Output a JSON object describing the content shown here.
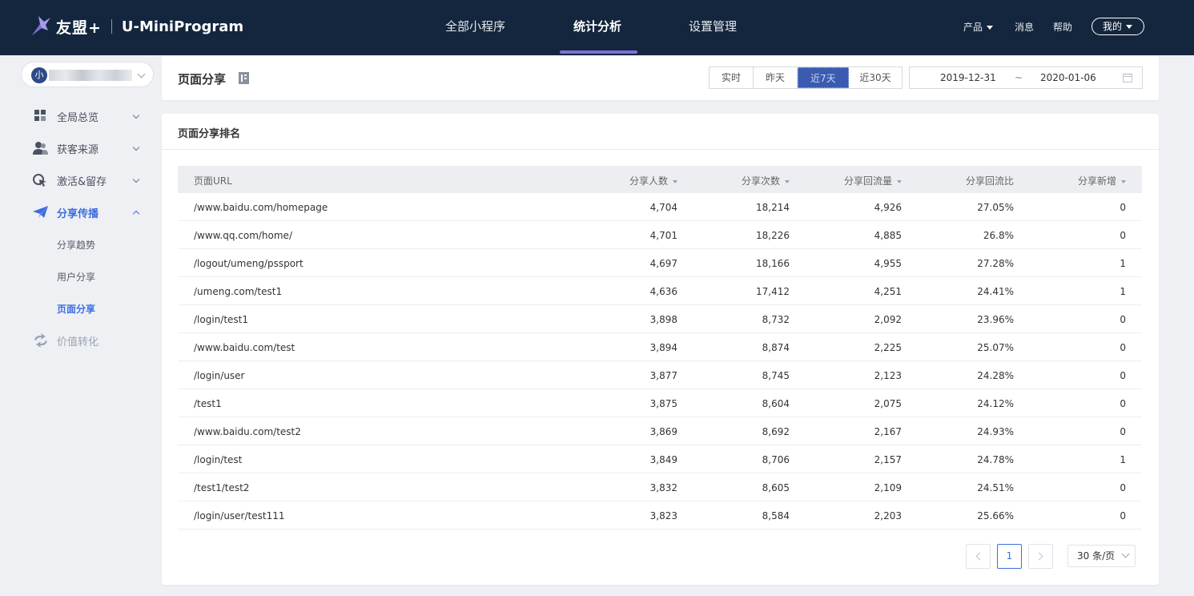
{
  "brand": {
    "name": "友盟+",
    "product": "U-MiniProgram"
  },
  "nav": {
    "tabs": [
      {
        "label": "全部小程序"
      },
      {
        "label": "统计分析"
      },
      {
        "label": "设置管理"
      }
    ],
    "active_tab": "统计分析",
    "right": {
      "product": "产品",
      "messages": "消息",
      "help": "帮助",
      "me": "我的"
    }
  },
  "sidebar": {
    "app_avatar": "小",
    "items": [
      {
        "label": "全局总览",
        "icon": "grid-icon"
      },
      {
        "label": "获客来源",
        "icon": "users-icon"
      },
      {
        "label": "激活&留存",
        "icon": "cursor-icon"
      },
      {
        "label": "分享传播",
        "icon": "paper-plane-icon"
      },
      {
        "label": "价值转化",
        "icon": "refresh-icon"
      }
    ],
    "subitems": [
      {
        "label": "分享趋势"
      },
      {
        "label": "用户分享"
      },
      {
        "label": "页面分享"
      }
    ],
    "active_subitem": "页面分享"
  },
  "header": {
    "title": "页面分享",
    "range_buttons": [
      "实时",
      "昨天",
      "近7天",
      "近30天"
    ],
    "active_range": "近7天",
    "date_start": "2019-12-31",
    "date_sep": "~",
    "date_end": "2020-01-06"
  },
  "table": {
    "section_title": "页面分享排名",
    "columns": [
      "页面URL",
      "分享人数",
      "分享次数",
      "分享回流量",
      "分享回流比",
      "分享新增"
    ],
    "rows": [
      [
        "/www.baidu.com/homepage",
        "4,704",
        "18,214",
        "4,926",
        "27.05%",
        "0"
      ],
      [
        "/www.qq.com/home/",
        "4,701",
        "18,226",
        "4,885",
        "26.8%",
        "0"
      ],
      [
        "/logout/umeng/pssport",
        "4,697",
        "18,166",
        "4,955",
        "27.28%",
        "1"
      ],
      [
        "/umeng.com/test1",
        "4,636",
        "17,412",
        "4,251",
        "24.41%",
        "1"
      ],
      [
        "/login/test1",
        "3,898",
        "8,732",
        "2,092",
        "23.96%",
        "0"
      ],
      [
        "/www.baidu.com/test",
        "3,894",
        "8,874",
        "2,225",
        "25.07%",
        "0"
      ],
      [
        "/login/user",
        "3,877",
        "8,745",
        "2,123",
        "24.28%",
        "0"
      ],
      [
        "/test1",
        "3,875",
        "8,604",
        "2,075",
        "24.12%",
        "0"
      ],
      [
        "/www.baidu.com/test2",
        "3,869",
        "8,692",
        "2,167",
        "24.93%",
        "0"
      ],
      [
        "/login/test",
        "3,849",
        "8,706",
        "2,157",
        "24.78%",
        "1"
      ],
      [
        "/test1/test2",
        "3,832",
        "8,605",
        "2,109",
        "24.51%",
        "0"
      ],
      [
        "/login/user/test111",
        "3,823",
        "8,584",
        "2,203",
        "25.66%",
        "0"
      ]
    ]
  },
  "pagination": {
    "current_page": "1",
    "page_size": "30 条/页"
  },
  "colors": {
    "topbar": "#13263d",
    "accent": "#3d6ee0",
    "nav_underline": "#7f6fd6"
  }
}
